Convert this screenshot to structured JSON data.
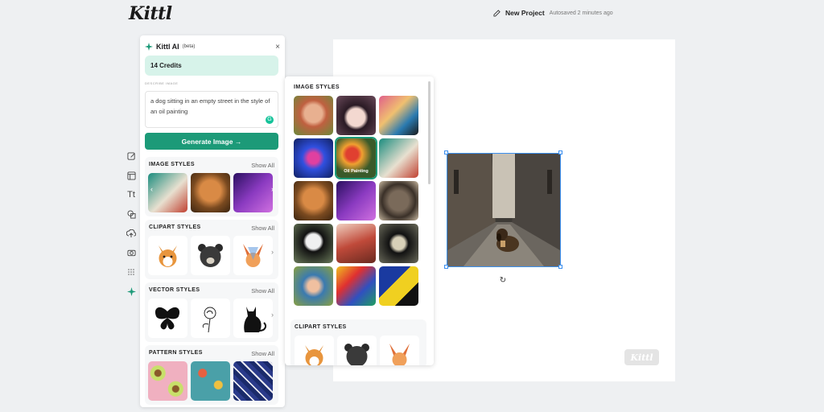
{
  "app": {
    "logo": "Kittl"
  },
  "header": {
    "project_name": "New Project",
    "autosave": "Autosaved 2 minutes ago"
  },
  "ai_panel": {
    "title": "Kittl AI",
    "beta": "(beta)",
    "close": "×",
    "credits": "14 Credits",
    "prompt_label": "DESCRIBE IMAGE",
    "prompt": "a dog sitting in an empty street in the style of an oil painting",
    "generate": "Generate Image →",
    "sections": [
      {
        "title": "IMAGE STYLES",
        "show_all": "Show All"
      },
      {
        "title": "CLIPART STYLES",
        "show_all": "Show All"
      },
      {
        "title": "VECTOR STYLES",
        "show_all": "Show All"
      },
      {
        "title": "PATTERN STYLES",
        "show_all": "Show All"
      }
    ]
  },
  "styles_panel": {
    "title": "IMAGE STYLES",
    "selected_label": "Oil Painting",
    "clipart_title": "CLIPART STYLES"
  },
  "watermark": "Kittl",
  "colors": {
    "accent": "#1c9a78",
    "credits_bg": "#d7f3ea",
    "selection": "#3b8ff0"
  }
}
